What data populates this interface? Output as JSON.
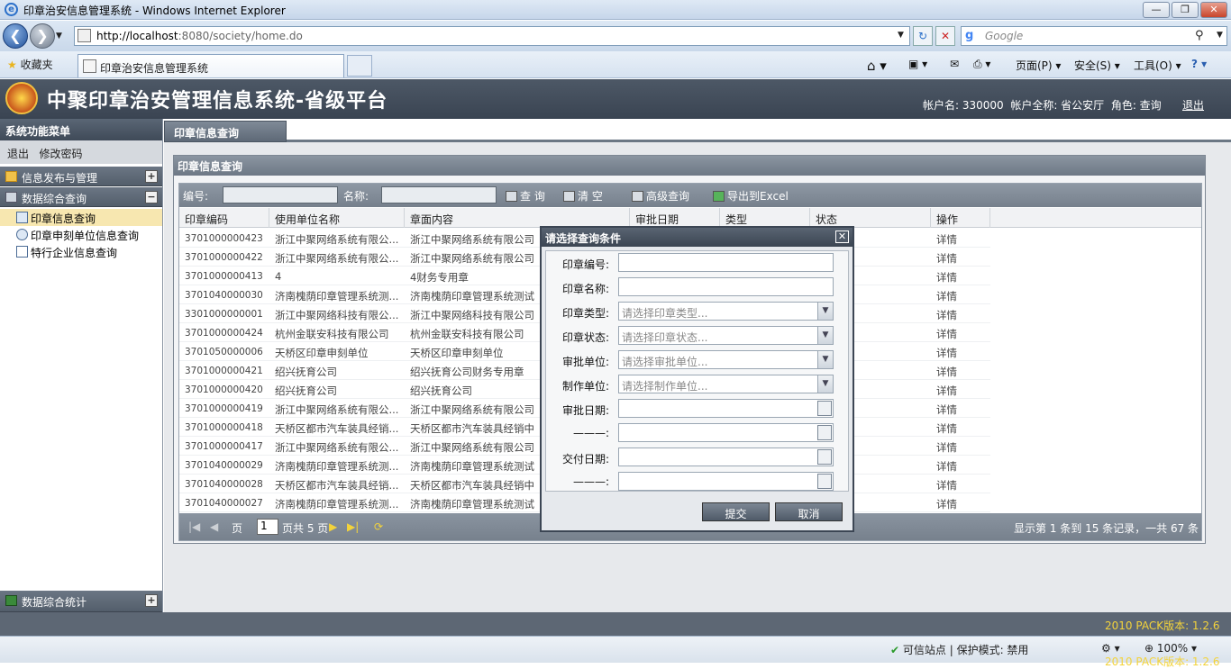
{
  "window": {
    "title": "印章治安信息管理系统 - Windows Internet Explorer"
  },
  "browser": {
    "url_host": "http://localhost",
    "url_rest": ":8080/society/home.do",
    "search_placeholder": "Google",
    "favorites": "收藏夹",
    "tab_title": "印章治安信息管理系统",
    "cmd_page": "页面(P)",
    "cmd_safety": "安全(S)",
    "cmd_tools": "工具(O)"
  },
  "header": {
    "title": "中聚印章治安管理信息系统-省级平台",
    "account_label": "帐户名: 330000",
    "fullname_label": "帐户全称: 省公安厅",
    "role_label": "角色: 查询",
    "logout": "退出"
  },
  "sidebar": {
    "title": "系统功能菜单",
    "link_logout": "退出",
    "link_password": "修改密码",
    "section1": "信息发布与管理",
    "section2": "数据综合查询",
    "items": [
      "印章信息查询",
      "印章申刻单位信息查询",
      "特行企业信息查询"
    ],
    "section3": "数据综合统计"
  },
  "main": {
    "tab": "印章信息查询",
    "panel_title": "印章信息查询",
    "toolbar": {
      "code_label": "编号:",
      "name_label": "名称:",
      "query": "查 询",
      "clear": "清 空",
      "advanced": "高级查询",
      "export": "导出到Excel"
    },
    "columns": [
      "印章编码",
      "使用单位名称",
      "章面内容",
      "审批日期",
      "类型",
      "状态",
      "操作"
    ],
    "rows": [
      [
        "3701000000423",
        "浙江中聚网络系统有限公...",
        "浙江中聚网络系统有限公司",
        "详情"
      ],
      [
        "3701000000422",
        "浙江中聚网络系统有限公...",
        "浙江中聚网络系统有限公司",
        "详情"
      ],
      [
        "3701000000413",
        "4",
        "4财务专用章",
        "详情"
      ],
      [
        "3701040000030",
        "济南槐荫印章管理系统测...",
        "济南槐荫印章管理系统测试",
        "详情"
      ],
      [
        "3301000000001",
        "浙江中聚网络科技有限公...",
        "浙江中聚网络科技有限公司",
        "详情"
      ],
      [
        "3701000000424",
        "杭州金联安科技有限公司",
        "杭州金联安科技有限公司",
        "详情"
      ],
      [
        "3701050000006",
        "天桥区印章申刻单位",
        "天桥区印章申刻单位",
        "详情"
      ],
      [
        "3701000000421",
        "绍兴抚育公司",
        "绍兴抚育公司财务专用章",
        "详情"
      ],
      [
        "3701000000420",
        "绍兴抚育公司",
        "绍兴抚育公司",
        "详情"
      ],
      [
        "3701000000419",
        "浙江中聚网络系统有限公...",
        "浙江中聚网络系统有限公司",
        "详情"
      ],
      [
        "3701000000418",
        "天桥区都市汽车装具经销...",
        "天桥区都市汽车装具经销中",
        "详情"
      ],
      [
        "3701000000417",
        "浙江中聚网络系统有限公...",
        "浙江中聚网络系统有限公司",
        "详情"
      ],
      [
        "3701040000029",
        "济南槐荫印章管理系统测...",
        "济南槐荫印章管理系统测试",
        "详情"
      ],
      [
        "3701040000028",
        "天桥区都市汽车装具经销...",
        "天桥区都市汽车装具经销中",
        "详情"
      ],
      [
        "3701040000027",
        "济南槐荫印章管理系统测...",
        "济南槐荫印章管理系统测试",
        "详情"
      ]
    ],
    "pager": {
      "page_label": "页",
      "page_value": "1",
      "total": "页共 5 页",
      "summary": "显示第 1 条到 15 条记录，一共 67 条"
    }
  },
  "dialog": {
    "title": "请选择查询条件",
    "fields": [
      {
        "label": "印章编号:",
        "placeholder": ""
      },
      {
        "label": "印章名称:",
        "placeholder": ""
      },
      {
        "label": "印章类型:",
        "placeholder": "请选择印章类型..."
      },
      {
        "label": "印章状态:",
        "placeholder": "请选择印章状态..."
      },
      {
        "label": "审批单位:",
        "placeholder": "请选择审批单位..."
      },
      {
        "label": "制作单位:",
        "placeholder": "请选择制作单位..."
      },
      {
        "label": "审批日期:",
        "placeholder": ""
      },
      {
        "label": "———:",
        "placeholder": ""
      },
      {
        "label": "交付日期:",
        "placeholder": ""
      },
      {
        "label": "———:",
        "placeholder": ""
      }
    ],
    "submit": "提交",
    "cancel": "取消"
  },
  "footer": {
    "version": "2010  PACK版本: 1.2.6",
    "zone": "可信站点 | 保护模式: 禁用",
    "zoom": "100%"
  }
}
